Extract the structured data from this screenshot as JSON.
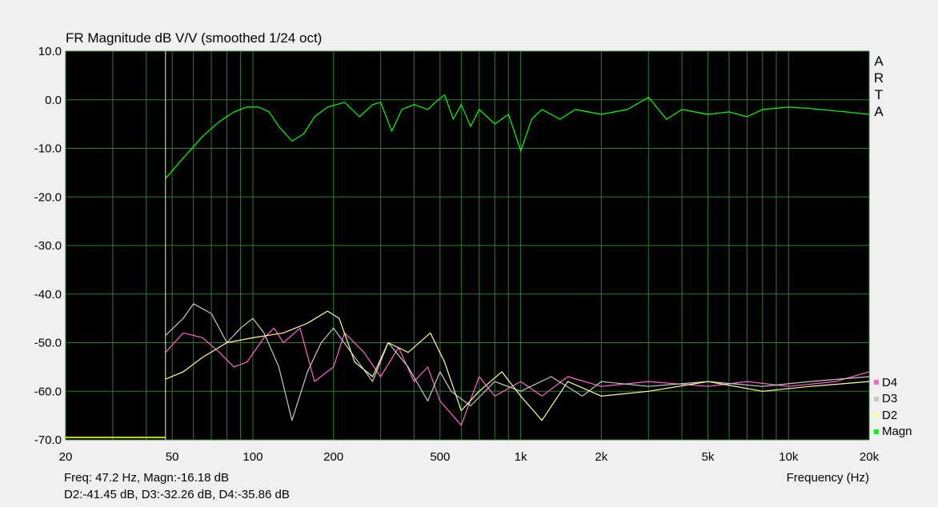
{
  "chart_data": {
    "type": "line",
    "title": "FR Magnitude dB V/V (smoothed 1/24 oct)",
    "xlabel": "Frequency (Hz)",
    "ylabel": "",
    "x_scale": "log",
    "xlim": [
      20,
      20000
    ],
    "ylim": [
      -70,
      10
    ],
    "x_tick_labels": [
      "20",
      "50",
      "100",
      "200",
      "500",
      "1k",
      "2k",
      "5k",
      "10k",
      "20k"
    ],
    "x_tick_values": [
      20,
      50,
      100,
      200,
      500,
      1000,
      2000,
      5000,
      10000,
      20000
    ],
    "y_tick_labels": [
      "10.0",
      "0.0",
      "-10.0",
      "-20.0",
      "-30.0",
      "-40.0",
      "-50.0",
      "-60.0",
      "-70.0"
    ],
    "y_tick_values": [
      10,
      0,
      -10,
      -20,
      -30,
      -40,
      -50,
      -60,
      -70
    ],
    "grid": true,
    "legend_position": "bottom-right",
    "background": "#000000",
    "cursor_frequency": 47.2,
    "series": [
      {
        "name": "D4",
        "color": "#ff66cc",
        "points": [
          [
            47.2,
            -52.0
          ],
          [
            55,
            -48
          ],
          [
            65,
            -49
          ],
          [
            75,
            -52
          ],
          [
            85,
            -55
          ],
          [
            95,
            -54
          ],
          [
            110,
            -49
          ],
          [
            120,
            -47
          ],
          [
            130,
            -50
          ],
          [
            150,
            -47
          ],
          [
            170,
            -58
          ],
          [
            200,
            -55
          ],
          [
            220,
            -48
          ],
          [
            260,
            -52
          ],
          [
            300,
            -57
          ],
          [
            350,
            -51
          ],
          [
            400,
            -58
          ],
          [
            450,
            -55
          ],
          [
            500,
            -62
          ],
          [
            600,
            -67
          ],
          [
            700,
            -57
          ],
          [
            800,
            -61
          ],
          [
            1000,
            -58
          ],
          [
            1200,
            -61
          ],
          [
            1500,
            -57
          ],
          [
            2000,
            -59
          ],
          [
            3000,
            -58
          ],
          [
            5000,
            -59
          ],
          [
            7000,
            -58
          ],
          [
            10000,
            -59
          ],
          [
            15000,
            -58
          ],
          [
            20000,
            -56
          ]
        ]
      },
      {
        "name": "D3",
        "color": "#c8c8c8",
        "points": [
          [
            47.2,
            -48.5
          ],
          [
            55,
            -45
          ],
          [
            60,
            -42
          ],
          [
            70,
            -44
          ],
          [
            80,
            -50
          ],
          [
            90,
            -47
          ],
          [
            100,
            -45
          ],
          [
            110,
            -48
          ],
          [
            125,
            -55
          ],
          [
            140,
            -66
          ],
          [
            160,
            -56
          ],
          [
            180,
            -50
          ],
          [
            200,
            -47
          ],
          [
            240,
            -53
          ],
          [
            280,
            -58
          ],
          [
            320,
            -50
          ],
          [
            380,
            -55
          ],
          [
            450,
            -62
          ],
          [
            500,
            -56
          ],
          [
            550,
            -60
          ],
          [
            650,
            -63
          ],
          [
            800,
            -58
          ],
          [
            1000,
            -60
          ],
          [
            1300,
            -57
          ],
          [
            1700,
            -61
          ],
          [
            2000,
            -58
          ],
          [
            3000,
            -59
          ],
          [
            5000,
            -58
          ],
          [
            8000,
            -59
          ],
          [
            12000,
            -58
          ],
          [
            20000,
            -57
          ]
        ]
      },
      {
        "name": "D2",
        "color": "#ffff99",
        "points": [
          [
            47.2,
            -57.5
          ],
          [
            55,
            -56
          ],
          [
            65,
            -53
          ],
          [
            80,
            -50
          ],
          [
            100,
            -49
          ],
          [
            130,
            -48
          ],
          [
            160,
            -46
          ],
          [
            190,
            -43.5
          ],
          [
            210,
            -45
          ],
          [
            240,
            -54
          ],
          [
            280,
            -57
          ],
          [
            320,
            -50
          ],
          [
            380,
            -52
          ],
          [
            460,
            -48
          ],
          [
            520,
            -54
          ],
          [
            600,
            -64
          ],
          [
            700,
            -60
          ],
          [
            850,
            -56
          ],
          [
            1000,
            -61
          ],
          [
            1200,
            -66
          ],
          [
            1500,
            -58
          ],
          [
            2000,
            -61
          ],
          [
            3000,
            -60
          ],
          [
            5000,
            -58
          ],
          [
            8000,
            -60
          ],
          [
            12000,
            -59
          ],
          [
            20000,
            -58
          ]
        ]
      },
      {
        "name": "Magn",
        "color": "#00ff00",
        "points": [
          [
            47.2,
            -16.2
          ],
          [
            55,
            -12
          ],
          [
            65,
            -7.5
          ],
          [
            75,
            -4.5
          ],
          [
            85,
            -2.5
          ],
          [
            95,
            -1.5
          ],
          [
            105,
            -1.5
          ],
          [
            115,
            -2.5
          ],
          [
            125,
            -5.5
          ],
          [
            140,
            -8.5
          ],
          [
            155,
            -7
          ],
          [
            170,
            -3.5
          ],
          [
            190,
            -1.5
          ],
          [
            220,
            -0.5
          ],
          [
            250,
            -3.5
          ],
          [
            280,
            -1
          ],
          [
            300,
            -0.5
          ],
          [
            330,
            -6.5
          ],
          [
            360,
            -2
          ],
          [
            400,
            -1
          ],
          [
            450,
            -2
          ],
          [
            480,
            -0.5
          ],
          [
            520,
            1
          ],
          [
            560,
            -4
          ],
          [
            600,
            -1
          ],
          [
            650,
            -5.5
          ],
          [
            700,
            -2
          ],
          [
            800,
            -5
          ],
          [
            900,
            -3
          ],
          [
            1000,
            -10.5
          ],
          [
            1100,
            -4
          ],
          [
            1200,
            -2
          ],
          [
            1400,
            -4
          ],
          [
            1600,
            -2
          ],
          [
            2000,
            -3
          ],
          [
            2500,
            -2
          ],
          [
            3000,
            0.5
          ],
          [
            3500,
            -4
          ],
          [
            4000,
            -2
          ],
          [
            5000,
            -3
          ],
          [
            6000,
            -2.5
          ],
          [
            7000,
            -3.5
          ],
          [
            8000,
            -2
          ],
          [
            10000,
            -1.5
          ],
          [
            12000,
            -1.8
          ],
          [
            15000,
            -2.3
          ],
          [
            20000,
            -3
          ]
        ]
      }
    ],
    "initial_flat_segment": {
      "x": [
        20,
        47.2
      ],
      "y": -69.5,
      "color": "#cccc00"
    }
  },
  "readout": {
    "line1": "Freq: 47.2 Hz, Magn:-16.18 dB",
    "line2": "D2:-41.45 dB, D3:-32.26 dB, D4:-35.86 dB"
  },
  "watermark": [
    "A",
    "R",
    "T",
    "A"
  ]
}
